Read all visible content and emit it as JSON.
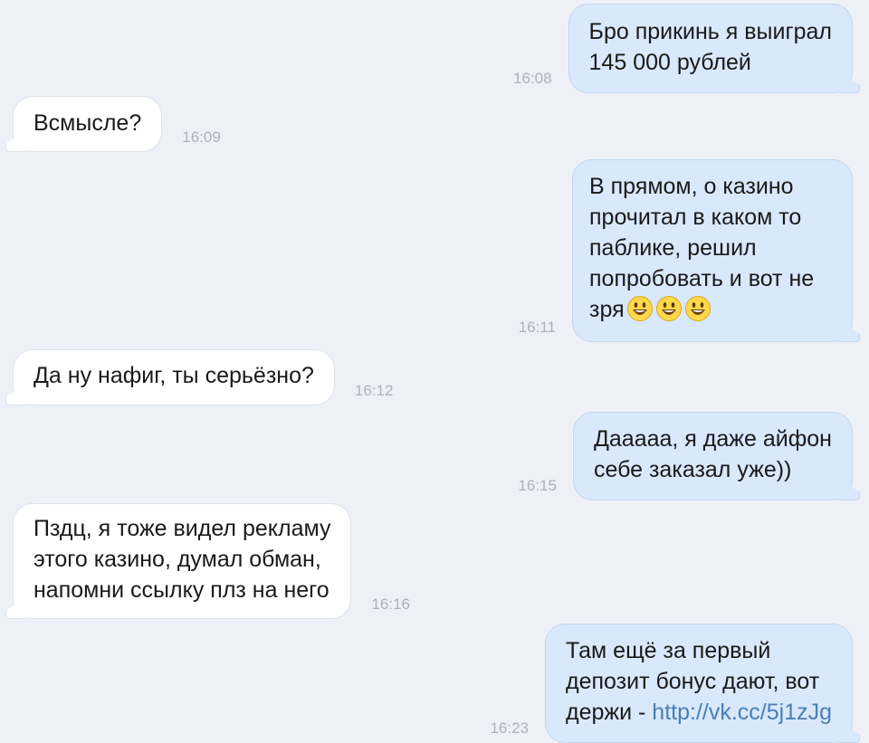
{
  "messages": [
    {
      "direction": "out",
      "text": "Бро прикинь я выиграл\n145 000 рублей",
      "time": "16:08"
    },
    {
      "direction": "in",
      "text": "Всмысле?",
      "time": "16:09"
    },
    {
      "direction": "out",
      "text": "В прямом, о казино\nпрочитал в каком то\nпаблике, решил\nпопробовать и вот не\nзря",
      "time": "16:11",
      "emoji": [
        "smiley-emoji",
        "smiley-emoji",
        "smiley-emoji"
      ]
    },
    {
      "direction": "in",
      "text": "Да ну нафиг, ты серьёзно?",
      "time": "16:12"
    },
    {
      "direction": "out",
      "text": "Даааaa, я даже айфон\nсебе заказал уже))",
      "time": "16:15"
    },
    {
      "direction": "in",
      "text": "Пздц, я тоже видел рекламу\nэтого казино, думал обман,\nнапомни ссылку плз на него",
      "time": "16:16"
    },
    {
      "direction": "out",
      "text": "Там ещё за первый\nдепозит бонус дают, вот\nдержи - ",
      "link": "http://vk.cc/5j1zJg",
      "time": "16:23"
    }
  ]
}
